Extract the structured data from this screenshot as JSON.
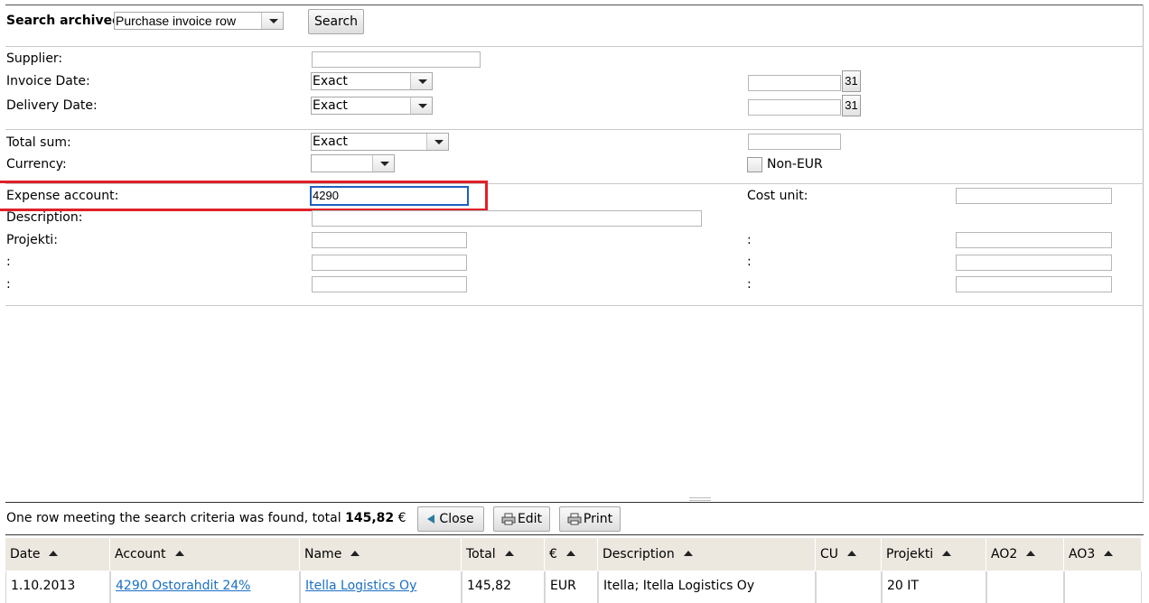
{
  "search": {
    "label": "Search archived",
    "type_value": "Purchase invoice row",
    "button": "Search"
  },
  "form": {
    "supplier_label": "Supplier:",
    "invoice_date_label": "Invoice Date:",
    "invoice_date_mode": "Exact",
    "delivery_date_label": "Delivery Date:",
    "delivery_date_mode": "Exact",
    "calendar_glyph": "31",
    "total_sum_label": "Total sum:",
    "total_sum_mode": "Exact",
    "currency_label": "Currency:",
    "currency_value": "",
    "non_eur_label": "Non-EUR",
    "expense_account_label": "Expense account:",
    "expense_account_value": "4290",
    "cost_unit_label": "Cost unit:",
    "description_label": "Description:",
    "projekti_label": "Projekti:",
    "colon": ":"
  },
  "results": {
    "summary_text": "One row meeting the search criteria was found, total ",
    "summary_total": "145,82",
    "summary_currency": " €",
    "close_button": "Close",
    "edit_button": "Edit",
    "print_button": "Print",
    "columns": [
      "Date",
      "Account",
      "Name",
      "Total",
      "€",
      "Description",
      "CU",
      "Projekti",
      "AO2",
      "AO3"
    ],
    "row": {
      "date": "1.10.2013",
      "account": "4290 Ostorahdit 24%",
      "name": "Itella Logistics Oy",
      "total": "145,82",
      "currency": "EUR",
      "description": "Itella; Itella Logistics Oy",
      "cu": "",
      "projekti": "20 IT",
      "ao2": "",
      "ao3": ""
    }
  },
  "colors": {
    "highlight": "#e0202a",
    "focus": "#1d5fbf",
    "link": "#1a6fc4",
    "header_bg": "#ece8e0"
  }
}
